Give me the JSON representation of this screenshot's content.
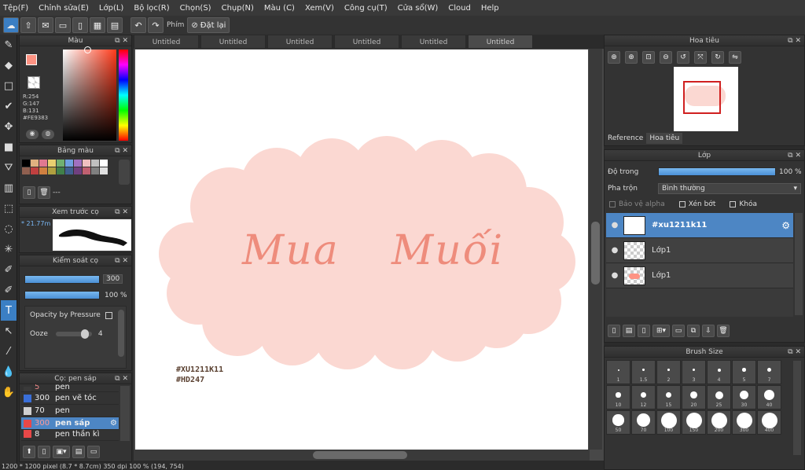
{
  "menu": [
    "Tệp(F)",
    "Chỉnh sửa(E)",
    "Lớp(L)",
    "Bộ lọc(R)",
    "Chọn(S)",
    "Chụp(N)",
    "Màu (C)",
    "Xem(V)",
    "Công cụ(T)",
    "Cửa sổ(W)",
    "Cloud",
    "Help"
  ],
  "toolbar": {
    "phim_label": "Phím",
    "reset_label": "Đặt lại"
  },
  "tabs": [
    "Untitled",
    "Untitled",
    "Untitled",
    "Untitled",
    "Untitled",
    "Untitled"
  ],
  "color_panel": {
    "title": "Màu",
    "r": "R:254",
    "g": "G:147",
    "b": "B:131",
    "hex": "#FE9383",
    "primary_color": "#fe9383"
  },
  "palette": {
    "title": "Bảng màu",
    "extra": "---"
  },
  "brush_preview": {
    "title": "Xem trước cọ",
    "size": "21.77m"
  },
  "brush_control": {
    "title": "Kiểm soát cọ",
    "size": "300",
    "opacity": "100 %",
    "opacity_by_pressure": "Opacity by Pressure",
    "ooze_label": "Ooze",
    "ooze_value": "4"
  },
  "brushes": {
    "title": "Cọ: pen sáp",
    "items": [
      {
        "size": "5",
        "name": "pen",
        "color": "#3a3a3a"
      },
      {
        "size": "300",
        "name": "pen vẽ tóc",
        "color": "#3a6fd8"
      },
      {
        "size": "70",
        "name": "pen",
        "color": "#d0d0d0"
      },
      {
        "size": "300",
        "name": "pen sáp",
        "color": "#e84848"
      },
      {
        "size": "8",
        "name": "pen thần kì",
        "color": "#e84848"
      }
    ]
  },
  "canvas": {
    "text1": "Mua",
    "text2": "Muối",
    "tag1": "#XU1211K11",
    "tag2": "#HD247"
  },
  "status": "1200 * 1200 pixel  (8.7 * 8.7cm)  350 dpi  100 %  (194, 754)",
  "navigator": {
    "title": "Hoa tiêu",
    "tab_reference": "Reference",
    "tab_navigator": "Hoa tiêu"
  },
  "layers": {
    "title": "Lớp",
    "opacity_label": "Độ trong",
    "opacity_value": "100 %",
    "blend_label": "Pha trộn",
    "blend_value": "Bình thường",
    "protect_alpha": "Bảo vệ alpha",
    "clipping": "Xén bớt",
    "lock": "Khóa",
    "items": [
      {
        "name": "#xu1211k11"
      },
      {
        "name": "Lớp1"
      },
      {
        "name": "Lớp1"
      }
    ]
  },
  "brush_size": {
    "title": "Brush Size",
    "sizes": [
      "1",
      "1.5",
      "2",
      "3",
      "4",
      "5",
      "7",
      "10",
      "12",
      "15",
      "20",
      "25",
      "30",
      "40",
      "50",
      "70",
      "100",
      "150",
      "200",
      "300",
      "400"
    ]
  }
}
